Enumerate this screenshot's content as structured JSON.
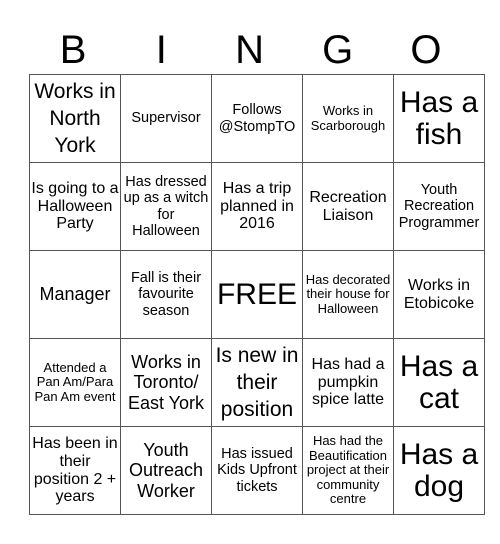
{
  "header": [
    "B",
    "I",
    "N",
    "G",
    "O"
  ],
  "rows": [
    [
      "Works in North York",
      "Supervisor",
      "Follows @StompTO",
      "Works in Scarborough",
      "Has a fish"
    ],
    [
      "Is going to a Halloween Party",
      "Has dressed up as a witch for Halloween",
      "Has a trip planned in 2016",
      "Recreation Liaison",
      "Youth Recreation Programmer"
    ],
    [
      "Manager",
      "Fall is their favourite season",
      "FREE",
      "Has decorated their house for Halloween",
      "Works in Etobicoke"
    ],
    [
      "Attended a Pan Am/Para Pan Am event",
      "Works in Toronto/ East York",
      "Is new in their position",
      "Has had a pumpkin spice latte",
      "Has a cat"
    ],
    [
      "Has been in their position 2 + years",
      "Youth Outreach Worker",
      "Has issued Kids Upfront tickets",
      "Has had the Beautification project at their community centre",
      "Has a dog"
    ]
  ]
}
